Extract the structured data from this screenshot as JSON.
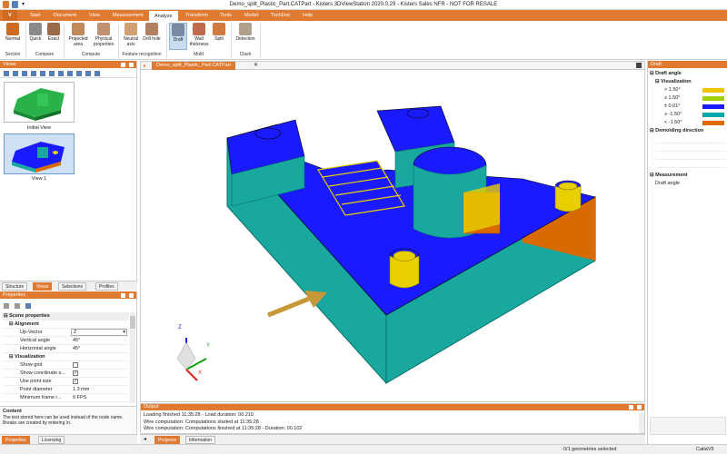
{
  "window": {
    "title": "Demo_split_Plastic_Part.CATPart - Kisters 3DViewStation 2020.0.29 - Kisters Sales NFR - NOT FOR RESALE"
  },
  "menu": {
    "app_button": "V",
    "items": [
      "Start",
      "Document",
      "View",
      "Measurement",
      "Analyze",
      "Transform",
      "Tools",
      "Model",
      "TechDoc",
      "Help"
    ],
    "active": "Analyze"
  },
  "ribbon": {
    "buttons": [
      "Normal",
      "Quick",
      "Exact",
      "Projected area",
      "Physical properties",
      "Neutral axis",
      "Drill hole",
      "Draft",
      "Wall thickness",
      "Split",
      "Detection"
    ],
    "groups": [
      "Section",
      "Compare",
      "Compute",
      "Feature recognition",
      "Mold",
      "Clash"
    ]
  },
  "views_panel": {
    "title": "Views",
    "thumbs": [
      "Initial View",
      "View 1"
    ],
    "tabs": [
      "Structure",
      "Views",
      "Selections",
      "Profiles"
    ]
  },
  "properties_panel": {
    "title": "Properties",
    "section_scene": "Scene properties",
    "section_alignment": "Alignment",
    "up_vector_label": "Up-Vector",
    "up_vector_value": "Z",
    "vertical_angle_label": "Vertical angle",
    "vertical_angle_value": "45°",
    "horizontal_angle_label": "Horizontal angle",
    "horizontal_angle_value": "45°",
    "section_visualization": "Visualization",
    "show_grid_label": "Show grid",
    "show_coord_label": "Show coordinate s...",
    "use_point_size_label": "Use point size",
    "point_diameter_label": "Point diameter",
    "point_diameter_value": "1.3 mm",
    "min_frame_label": "Minimum frame r...",
    "min_frame_value": "0 FPS",
    "content_title": "Content",
    "content_text": "The text stored here can be used instead of the node name. Breaks are created by entering \\n.",
    "tabs": [
      "Properties",
      "Licensing"
    ]
  },
  "viewport": {
    "doc_tab": "Demo_split_Plastic_Part.CATPart",
    "axes": [
      "Z",
      "Y",
      "X"
    ]
  },
  "output_panel": {
    "title": "Output",
    "lines": [
      "Loading finished 11:35:28 - Load duration: 00.210",
      "Wire computation: Computations started at 11:35:28",
      "Wire computation: Computations finished at 11:35:28 - Duration: 00.102"
    ],
    "tabs": [
      "Progress",
      "Information"
    ]
  },
  "draft_panel": {
    "title": "Draft",
    "draft_angle": "Draft angle",
    "visualization": "Visualization",
    "legend": [
      {
        "label": "> 1.50°",
        "color": "#f2c400"
      },
      {
        "label": "≥ 1.50°",
        "color": "#a0d000"
      },
      {
        "label": "± 0.01°",
        "color": "#1a1aff"
      },
      {
        "label": "≥ -1.50°",
        "color": "#00a8a8"
      },
      {
        "label": "< -1.50°",
        "color": "#e06a00"
      }
    ],
    "demolding": "Demolding direction",
    "measurement": "Measurement",
    "measurement_item": "Draft angle"
  },
  "statusbar": {
    "geometries": "0/1 geometries selected",
    "unit": "CatiaV5"
  },
  "colors": {
    "accent": "#e07a30",
    "model_blue": "#1a1aff",
    "model_teal": "#18a8a0",
    "model_orange": "#d86a00",
    "model_yellow": "#e8d000"
  }
}
